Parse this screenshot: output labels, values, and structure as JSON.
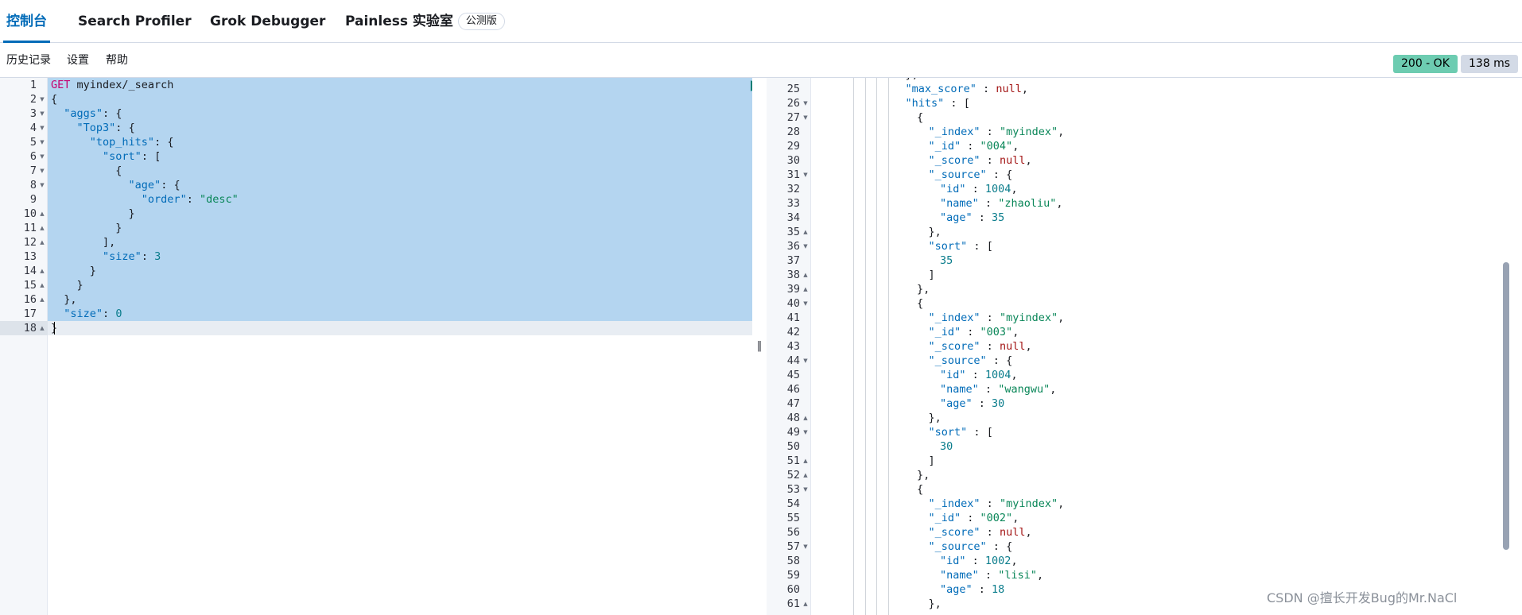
{
  "tabs": [
    {
      "label": "控制台",
      "active": true
    },
    {
      "label": "Search Profiler"
    },
    {
      "label": "Grok Debugger"
    },
    {
      "label": "Painless 实验室",
      "badge": "公测版"
    }
  ],
  "submenu": [
    "历史记录",
    "设置",
    "帮助"
  ],
  "status": {
    "code": "200 - OK",
    "time": "138 ms"
  },
  "colors": {
    "accent": "#006bb8",
    "ok": "#6dccb1",
    "selection": "#b4d5f0"
  },
  "icons": {
    "run": "play-icon",
    "settings": "wrench-icon"
  },
  "request": {
    "lines": [
      "GET myindex/_search",
      "{",
      "  \"aggs\": {",
      "    \"Top3\": {",
      "      \"top_hits\": {",
      "        \"sort\": [",
      "          {",
      "            \"age\": {",
      "              \"order\": \"desc\"",
      "            }",
      "          }",
      "        ],",
      "        \"size\": 3",
      "      }",
      "    }",
      "  },",
      "  \"size\": 0",
      "}"
    ]
  },
  "response": {
    "first_line_number": 24,
    "lines": [
      "},",
      "\"max_score\" : null,",
      "\"hits\" : [",
      "{",
      "\"_index\" : \"myindex\",",
      "\"_id\" : \"004\",",
      "\"_score\" : null,",
      "\"_source\" : {",
      "\"id\" : 1004,",
      "\"name\" : \"zhaoliu\",",
      "\"age\" : 35",
      "},",
      "\"sort\" : [",
      "35",
      "]",
      "},",
      "{",
      "\"_index\" : \"myindex\",",
      "\"_id\" : \"003\",",
      "\"_score\" : null,",
      "\"_source\" : {",
      "\"id\" : 1004,",
      "\"name\" : \"wangwu\",",
      "\"age\" : 30",
      "},",
      "\"sort\" : [",
      "30",
      "]",
      "},",
      "{",
      "\"_index\" : \"myindex\",",
      "\"_id\" : \"002\",",
      "\"_score\" : null,",
      "\"_source\" : {",
      "\"id\" : 1002,",
      "\"name\" : \"lisi\",",
      "\"age\" : 18",
      "},"
    ]
  },
  "watermark": "CSDN @擅长开发Bug的Mr.NaCl"
}
